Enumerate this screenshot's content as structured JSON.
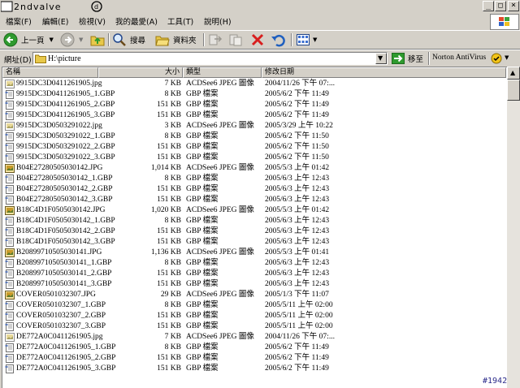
{
  "window": {
    "title_logo": "2ndvalve",
    "minimize_glyph": "_",
    "maximize_glyph": "□",
    "close_glyph": "×"
  },
  "menu": [
    {
      "label": "檔案(F)"
    },
    {
      "label": "編輯(E)"
    },
    {
      "label": "檢視(V)"
    },
    {
      "label": "我的最愛(A)"
    },
    {
      "label": "工具(T)"
    },
    {
      "label": "說明(H)"
    }
  ],
  "toolbar": {
    "back_label": "上一頁",
    "search_label": "搜尋",
    "folders_label": "資料夾"
  },
  "address": {
    "label": "網址(D)",
    "value": "H:\\picture",
    "go_label": "移至",
    "norton_label": "Norton AntiVirus"
  },
  "columns": {
    "name": "名稱",
    "size": "大小",
    "type": "類型",
    "modified": "修改日期"
  },
  "files": [
    {
      "name": "9915DC3D0411261905.jpg",
      "size": "7 KB",
      "type": "ACDSee6 JPEG 圖像",
      "date": "2004/11/26 下午 07:...",
      "icon": "jpeg-icon"
    },
    {
      "name": "9915DC3D0411261905_1.GBP",
      "size": "8 KB",
      "type": "GBP 檔案",
      "date": "2005/6/2 下午 11:49",
      "icon": "gbp-icon"
    },
    {
      "name": "9915DC3D0411261905_2.GBP",
      "size": "151 KB",
      "type": "GBP 檔案",
      "date": "2005/6/2 下午 11:49",
      "icon": "gbp-icon"
    },
    {
      "name": "9915DC3D0411261905_3.GBP",
      "size": "151 KB",
      "type": "GBP 檔案",
      "date": "2005/6/2 下午 11:49",
      "icon": "gbp-icon"
    },
    {
      "name": "9915DC3D0503291022.jpg",
      "size": "3 KB",
      "type": "ACDSee6 JPEG 圖像",
      "date": "2005/3/29 上午 10:22",
      "icon": "jpeg-icon"
    },
    {
      "name": "9915DC3D0503291022_1.GBP",
      "size": "8 KB",
      "type": "GBP 檔案",
      "date": "2005/6/2 下午 11:50",
      "icon": "gbp-icon"
    },
    {
      "name": "9915DC3D0503291022_2.GBP",
      "size": "151 KB",
      "type": "GBP 檔案",
      "date": "2005/6/2 下午 11:50",
      "icon": "gbp-icon"
    },
    {
      "name": "9915DC3D0503291022_3.GBP",
      "size": "151 KB",
      "type": "GBP 檔案",
      "date": "2005/6/2 下午 11:50",
      "icon": "gbp-icon"
    },
    {
      "name": "B04E27280505030142.JPG",
      "size": "1,014 KB",
      "type": "ACDSee6 JPEG 圖像",
      "date": "2005/5/3 上午 01:42",
      "icon": "jpeg-photo-icon"
    },
    {
      "name": "B04E27280505030142_1.GBP",
      "size": "8 KB",
      "type": "GBP 檔案",
      "date": "2005/6/3 上午 12:43",
      "icon": "gbp-icon"
    },
    {
      "name": "B04E27280505030142_2.GBP",
      "size": "151 KB",
      "type": "GBP 檔案",
      "date": "2005/6/3 上午 12:43",
      "icon": "gbp-icon"
    },
    {
      "name": "B04E27280505030142_3.GBP",
      "size": "151 KB",
      "type": "GBP 檔案",
      "date": "2005/6/3 上午 12:43",
      "icon": "gbp-icon"
    },
    {
      "name": "B18C4D1F0505030142.JPG",
      "size": "1,020 KB",
      "type": "ACDSee6 JPEG 圖像",
      "date": "2005/5/3 上午 01:42",
      "icon": "jpeg-photo-icon"
    },
    {
      "name": "B18C4D1F0505030142_1.GBP",
      "size": "8 KB",
      "type": "GBP 檔案",
      "date": "2005/6/3 上午 12:43",
      "icon": "gbp-icon"
    },
    {
      "name": "B18C4D1F0505030142_2.GBP",
      "size": "151 KB",
      "type": "GBP 檔案",
      "date": "2005/6/3 上午 12:43",
      "icon": "gbp-icon"
    },
    {
      "name": "B18C4D1F0505030142_3.GBP",
      "size": "151 KB",
      "type": "GBP 檔案",
      "date": "2005/6/3 上午 12:43",
      "icon": "gbp-icon"
    },
    {
      "name": "B20899710505030141.JPG",
      "size": "1,136 KB",
      "type": "ACDSee6 JPEG 圖像",
      "date": "2005/5/3 上午 01:41",
      "icon": "jpeg-photo-icon"
    },
    {
      "name": "B20899710505030141_1.GBP",
      "size": "8 KB",
      "type": "GBP 檔案",
      "date": "2005/6/3 上午 12:43",
      "icon": "gbp-icon"
    },
    {
      "name": "B20899710505030141_2.GBP",
      "size": "151 KB",
      "type": "GBP 檔案",
      "date": "2005/6/3 上午 12:43",
      "icon": "gbp-icon"
    },
    {
      "name": "B20899710505030141_3.GBP",
      "size": "151 KB",
      "type": "GBP 檔案",
      "date": "2005/6/3 上午 12:43",
      "icon": "gbp-icon"
    },
    {
      "name": "COVER0501032307.JPG",
      "size": "29 KB",
      "type": "ACDSee6 JPEG 圖像",
      "date": "2005/1/3 下午 11:07",
      "icon": "jpeg-photo-icon"
    },
    {
      "name": "COVER0501032307_1.GBP",
      "size": "8 KB",
      "type": "GBP 檔案",
      "date": "2005/5/11 上午 02:00",
      "icon": "gbp-icon"
    },
    {
      "name": "COVER0501032307_2.GBP",
      "size": "151 KB",
      "type": "GBP 檔案",
      "date": "2005/5/11 上午 02:00",
      "icon": "gbp-icon"
    },
    {
      "name": "COVER0501032307_3.GBP",
      "size": "151 KB",
      "type": "GBP 檔案",
      "date": "2005/5/11 上午 02:00",
      "icon": "gbp-icon"
    },
    {
      "name": "DE772A0C0411261905.jpg",
      "size": "7 KB",
      "type": "ACDSee6 JPEG 圖像",
      "date": "2004/11/26 下午 07:...",
      "icon": "jpeg-icon"
    },
    {
      "name": "DE772A0C0411261905_1.GBP",
      "size": "8 KB",
      "type": "GBP 檔案",
      "date": "2005/6/2 下午 11:49",
      "icon": "gbp-icon"
    },
    {
      "name": "DE772A0C0411261905_2.GBP",
      "size": "151 KB",
      "type": "GBP 檔案",
      "date": "2005/6/2 下午 11:49",
      "icon": "gbp-icon"
    },
    {
      "name": "DE772A0C0411261905_3.GBP",
      "size": "151 KB",
      "type": "GBP 檔案",
      "date": "2005/6/2 下午 11:49",
      "icon": "gbp-icon"
    }
  ],
  "watermark": "#1942",
  "colors": {
    "face": "#d4d0c8",
    "window": "#ffffff",
    "go_arrow": "#2e9a2e",
    "delete_x": "#d81e1e",
    "undo_arrow": "#1f5fbf"
  }
}
